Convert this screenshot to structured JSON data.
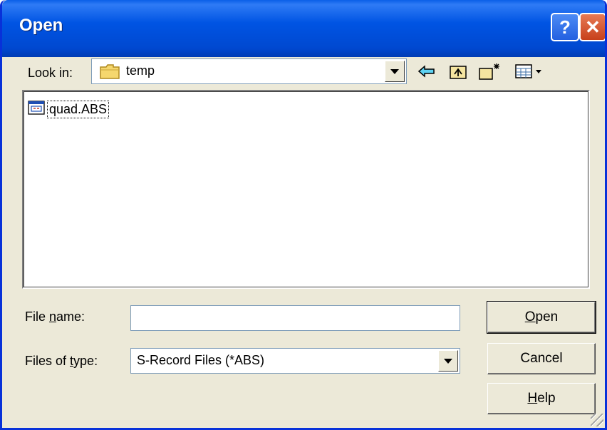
{
  "window": {
    "title": "Open"
  },
  "titlebar_buttons": {
    "help": "?",
    "close": "✕"
  },
  "look_in": {
    "label": "Look in:",
    "value": "temp"
  },
  "toolbar": {
    "back_icon": "back-arrow-icon",
    "up_icon": "up-folder-icon",
    "new_folder_icon": "new-folder-icon",
    "views_icon": "views-menu-icon"
  },
  "files": [
    {
      "name": "quad.ABS",
      "icon": "abs-file-icon"
    }
  ],
  "file_name": {
    "label": "File name:",
    "value": ""
  },
  "files_of_type": {
    "label": "Files of type:",
    "value": "S-Record Files (*ABS)"
  },
  "buttons": {
    "open": "Open",
    "cancel": "Cancel",
    "help": "Help"
  },
  "colors": {
    "titlebar": "#0054E3",
    "dialog_bg": "#ECE9D8",
    "field_border": "#7F9DB9"
  }
}
